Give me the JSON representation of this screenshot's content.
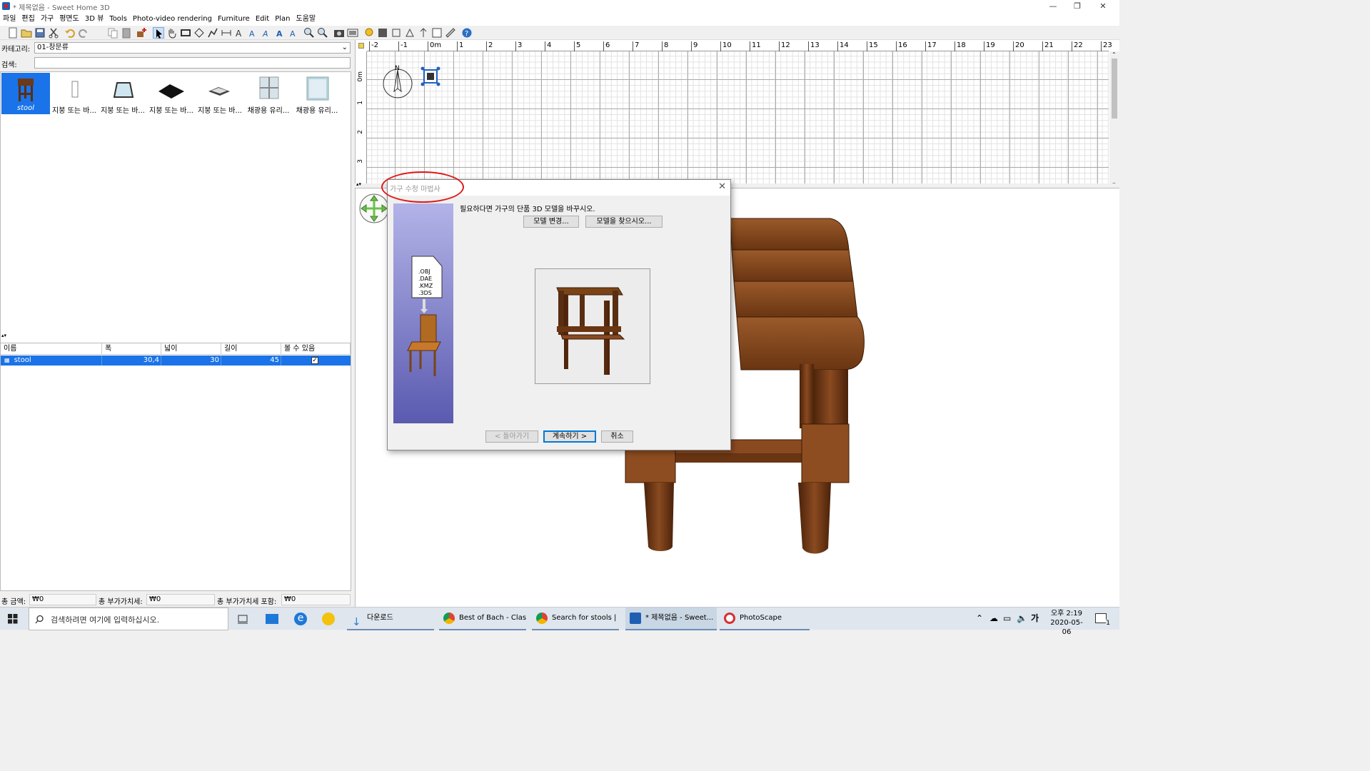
{
  "window": {
    "title": "* 제목없음 - Sweet Home 3D",
    "minimize": "—",
    "maximize": "❐",
    "close": "✕"
  },
  "menu": [
    "파일",
    "편집",
    "가구",
    "평면도",
    "3D 뷰",
    "Tools",
    "Photo-video rendering",
    "Furniture",
    "Edit",
    "Plan",
    "도움말"
  ],
  "toolbar_icons": [
    "new-file-icon",
    "open-icon",
    "save-icon",
    "cut-icon",
    "undo-icon",
    "redo-icon",
    "copy-icon",
    "paste-icon",
    "add-furniture-icon",
    "select-icon",
    "pan-icon",
    "create-walls-icon",
    "create-rooms-icon",
    "create-polylines-icon",
    "create-dimensions-icon",
    "add-text-icon",
    "zoom-in-icon",
    "zoom-out-icon",
    "create-photo-icon",
    "create-video-icon",
    "help-icon"
  ],
  "catalog": {
    "category_label": "카테고리:",
    "category_value": "01-창문류",
    "search_label": "검색:",
    "search_value": "",
    "items": [
      {
        "label": "stool",
        "icon": "stool-icon",
        "selected": true
      },
      {
        "label": "지붕 또는 바...",
        "icon": "door-icon"
      },
      {
        "label": "지붕 또는 바...",
        "icon": "skylight-icon"
      },
      {
        "label": "지붕 또는 바...",
        "icon": "roof-window-icon"
      },
      {
        "label": "지붕 또는 바...",
        "icon": "flat-window-icon"
      },
      {
        "label": "채광용 유리...",
        "icon": "window-icon"
      },
      {
        "label": "채광용 유리...",
        "icon": "glass-block-icon"
      }
    ]
  },
  "furniture_table": {
    "headers": [
      "이름",
      "폭",
      "넓이",
      "길이",
      "볼 수 있음"
    ],
    "rows": [
      {
        "name": "stool",
        "width": "30,4",
        "depth": "30",
        "height": "45",
        "visible": true
      }
    ]
  },
  "totals": {
    "total_label": "총 금액:",
    "total_value": "₩0",
    "vat_label": "총 부가가치세:",
    "vat_value": "₩0",
    "incl_label": "총 부가가치세 포함:",
    "incl_value": "₩0"
  },
  "plan": {
    "ruler_top": [
      "-2",
      "-1",
      "0m",
      "1",
      "2",
      "3",
      "4",
      "5",
      "6",
      "7",
      "8",
      "9",
      "10",
      "11",
      "12",
      "13",
      "14",
      "15",
      "16",
      "17",
      "18",
      "19",
      "20",
      "21",
      "22",
      "23"
    ],
    "ruler_left": [
      "0m",
      "1",
      "2",
      "3"
    ],
    "compass_north": "N"
  },
  "dialog": {
    "title": "가구 수정 마법사",
    "close": "✕",
    "instruction": "필요하다면 가구의 단품 3D 모델을 바꾸시오.",
    "change_model_button": "모델 변경...",
    "find_model_button": "모델을 찾으시오...",
    "formats": [
      ".OBJ",
      ".DAE",
      ".KMZ",
      ".3DS"
    ],
    "back_button": "< 돌아가기",
    "continue_button": "계속하기 >",
    "cancel_button": "취소"
  },
  "taskbar": {
    "search_placeholder": "검색하려면 여기에 입력하십시오.",
    "apps": [
      {
        "label": "다운로드",
        "color": "#2f7ad8"
      },
      {
        "label": "Best of Bach - Clas...",
        "color": "#e24a3a"
      },
      {
        "label": "Search for stools | ...",
        "color": "#e24a3a"
      },
      {
        "label": "* 제목없음 - Sweet...",
        "color": "#1e5fb3"
      },
      {
        "label": "PhotoScape",
        "color": "#d83030"
      }
    ],
    "ime": "가",
    "time": "오후 2:19",
    "date": "2020-05-06",
    "notif_count": "1"
  }
}
